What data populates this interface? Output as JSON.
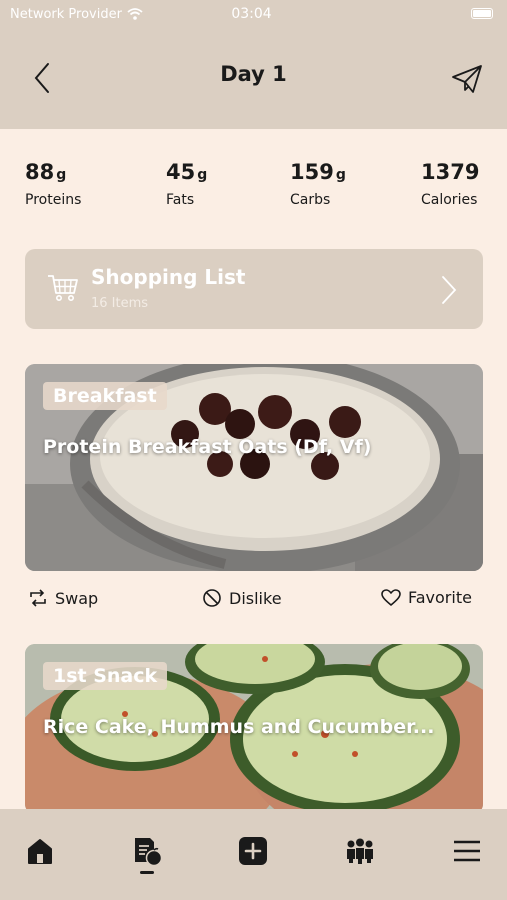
{
  "status": {
    "carrier": "Network Provider",
    "time": "03:04"
  },
  "header": {
    "title": "Day 1"
  },
  "macros": [
    {
      "value": "88",
      "unit": "g",
      "label": "Proteins"
    },
    {
      "value": "45",
      "unit": "g",
      "label": "Fats"
    },
    {
      "value": "159",
      "unit": "g",
      "label": "Carbs"
    },
    {
      "value": "1379",
      "unit": "",
      "label": "Calories"
    }
  ],
  "shopping": {
    "title": "Shopping List",
    "subtitle": "16 Items"
  },
  "meals": [
    {
      "tag": "Breakfast",
      "name": "Protein Breakfast Oats (Df, Vf)"
    },
    {
      "tag": "1st Snack",
      "name": "Rice Cake, Hummus and Cucumber..."
    }
  ],
  "actions": {
    "swap": "Swap",
    "dislike": "Dislike",
    "favorite": "Favorite"
  },
  "tabs": [
    "home-icon",
    "meal-plan-icon",
    "add-icon",
    "community-icon",
    "menu-icon"
  ],
  "colors": {
    "header_bg": "#dbcfc2",
    "page_bg": "#fbeee4",
    "text": "#1a1a1a"
  }
}
